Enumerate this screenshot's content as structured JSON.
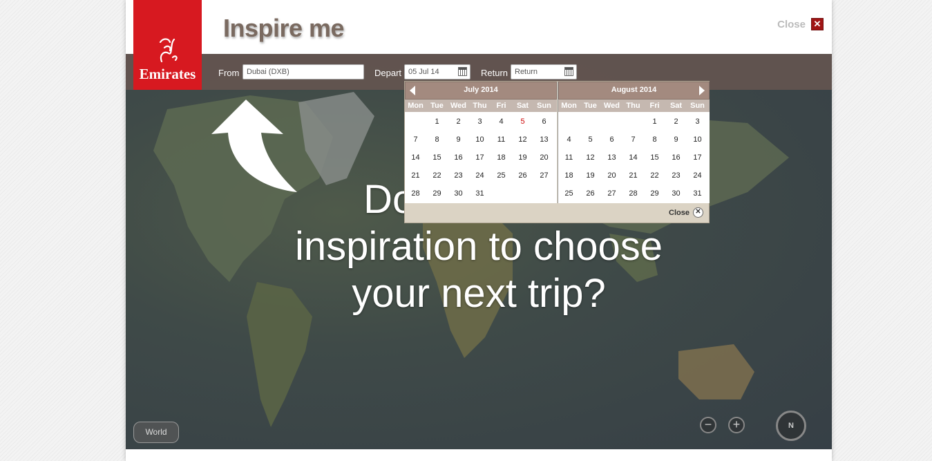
{
  "header": {
    "title": "Inspire me",
    "close_label": "Close",
    "close_icon": "close-icon"
  },
  "logo": {
    "brand": "Emirates"
  },
  "search": {
    "from_label": "From",
    "from_value": "Dubai (DXB)",
    "depart_label": "Depart",
    "depart_value": "05 Jul 14",
    "return_label": "Return",
    "return_placeholder": "Return"
  },
  "headline": {
    "line1": "Do you",
    "line2": "inspiration to choose",
    "line3": "your next trip?"
  },
  "calendar": {
    "weekdays": [
      "Mon",
      "Tue",
      "Wed",
      "Thu",
      "Fri",
      "Sat",
      "Sun"
    ],
    "months": [
      {
        "title": "July 2014",
        "offset": 1,
        "days": 31,
        "highlight": 5
      },
      {
        "title": "August 2014",
        "offset": 4,
        "days": 31,
        "highlight": null
      }
    ],
    "close_label": "Close"
  },
  "map": {
    "world_label": "World",
    "zoom_out": "−",
    "zoom_in": "+",
    "compass": "N"
  },
  "colors": {
    "brand_red": "#d71920",
    "close_red": "#a01515",
    "calendar_header": "#a38a7f",
    "searchbar": "#645550"
  }
}
